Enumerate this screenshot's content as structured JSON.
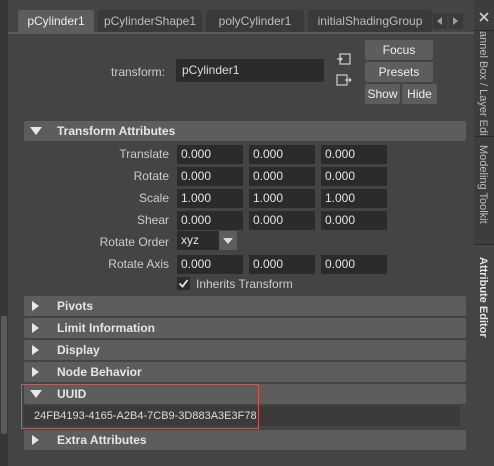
{
  "tabs": [
    {
      "label": "pCylinder1",
      "active": true
    },
    {
      "label": "pCylinderShape1",
      "active": false
    },
    {
      "label": "polyCylinder1",
      "active": false
    },
    {
      "label": "initialShadingGroup",
      "active": false
    }
  ],
  "header": {
    "transform_label": "transform:",
    "transform_value": "pCylinder1",
    "focus_label": "Focus",
    "presets_label": "Presets",
    "show_label": "Show",
    "hide_label": "Hide"
  },
  "sections": {
    "transform_attributes": {
      "title": "Transform Attributes",
      "expanded": true,
      "rows": [
        {
          "label": "Translate",
          "values": [
            "0.000",
            "0.000",
            "0.000"
          ]
        },
        {
          "label": "Rotate",
          "values": [
            "0.000",
            "0.000",
            "0.000"
          ]
        },
        {
          "label": "Scale",
          "values": [
            "1.000",
            "1.000",
            "1.000"
          ]
        },
        {
          "label": "Shear",
          "values": [
            "0.000",
            "0.000",
            "0.000"
          ]
        }
      ],
      "rotate_order_label": "Rotate Order",
      "rotate_order_value": "xyz",
      "rotate_axis_label": "Rotate Axis",
      "rotate_axis_values": [
        "0.000",
        "0.000",
        "0.000"
      ],
      "inherits_transform_label": "Inherits Transform",
      "inherits_transform_checked": true
    },
    "pivots": {
      "title": "Pivots",
      "expanded": false
    },
    "limit_information": {
      "title": "Limit Information",
      "expanded": false
    },
    "display": {
      "title": "Display",
      "expanded": false
    },
    "node_behavior": {
      "title": "Node Behavior",
      "expanded": false
    },
    "uuid": {
      "title": "UUID",
      "expanded": true,
      "value": "24FB4193-4165-A2B4-7CB9-3D883A3E3F78"
    },
    "extra_attributes": {
      "title": "Extra Attributes",
      "expanded": false
    }
  },
  "dock_tabs": [
    {
      "label": "annel Box / Layer Editor",
      "active": false
    },
    {
      "label": "Modeling Toolkit",
      "active": false
    },
    {
      "label": "Attribute Editor",
      "active": true
    }
  ],
  "colors": {
    "panel_bg": "#444444",
    "frame_bg": "#5d5d5d",
    "field_bg": "#2b2b2b",
    "highlight_border": "#d9534f"
  }
}
